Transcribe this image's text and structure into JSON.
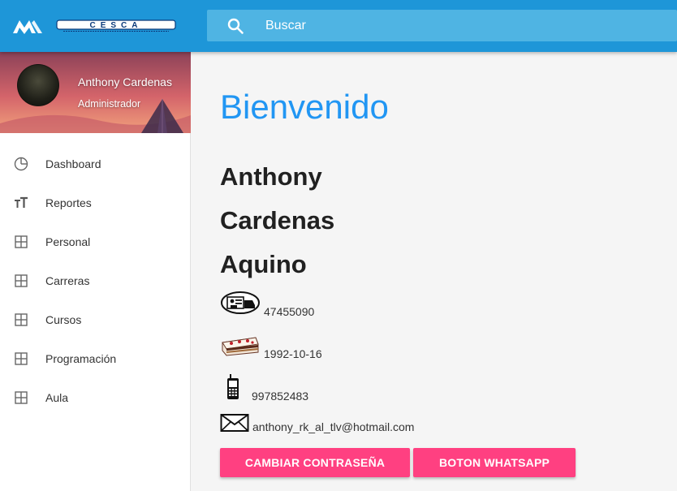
{
  "brand": {
    "logo_mark_icon": "m-logo-icon",
    "logo_wordmark": "CESCA"
  },
  "search": {
    "placeholder": "Buscar",
    "icon": "search-icon"
  },
  "sidebar": {
    "profile": {
      "name": "Anthony Cardenas",
      "role": "Administrador"
    },
    "items": [
      {
        "label": "Dashboard",
        "icon": "pie-chart-icon"
      },
      {
        "label": "Reportes",
        "icon": "text-size-icon"
      },
      {
        "label": "Personal",
        "icon": "grid-icon"
      },
      {
        "label": "Carreras",
        "icon": "grid-icon"
      },
      {
        "label": "Cursos",
        "icon": "grid-icon"
      },
      {
        "label": "Programación",
        "icon": "grid-icon"
      },
      {
        "label": "Aula",
        "icon": "grid-icon"
      }
    ]
  },
  "main": {
    "welcome": "Bienvenido",
    "first_name": "Anthony",
    "last_name_1": "Cardenas",
    "last_name_2": "Aquino",
    "dni": "47455090",
    "birthdate": "1992-10-16",
    "phone": "997852483",
    "email": "anthony_rk_al_tlv@hotmail.com",
    "btn_change_password": "CAMBIAR CONTRASEÑA",
    "btn_whatsapp": "BOTON WHATSAPP"
  },
  "colors": {
    "topbar": "#1e96d8",
    "accent_blue": "#2196f3",
    "button_pink": "#ff4081"
  }
}
